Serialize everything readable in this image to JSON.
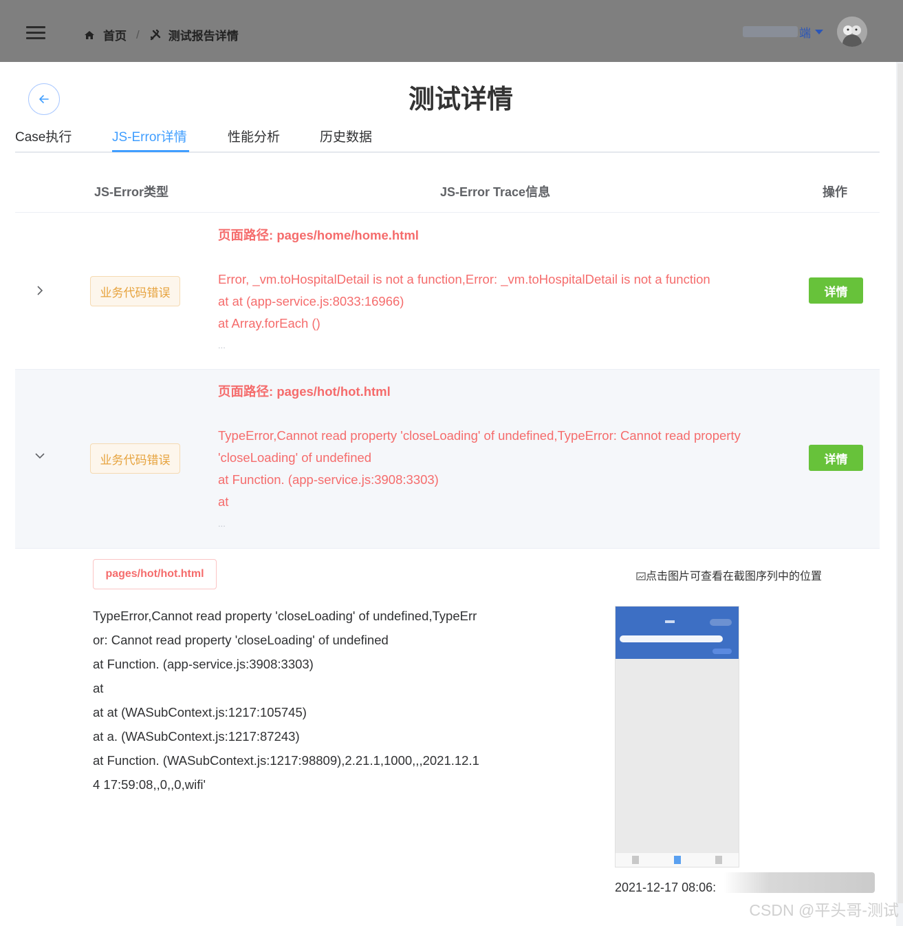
{
  "header": {
    "breadcrumb": [
      {
        "label": "首页",
        "icon": "home-icon"
      },
      {
        "label": "测试报告详情",
        "icon": "tools-icon"
      }
    ],
    "user_name": "端"
  },
  "page": {
    "title": "测试详情"
  },
  "tabs": [
    {
      "label": "Case执行",
      "active": false
    },
    {
      "label": "JS-Error详情",
      "active": true
    },
    {
      "label": "性能分析",
      "active": false
    },
    {
      "label": "历史数据",
      "active": false
    }
  ],
  "table": {
    "headers": {
      "type": "JS-Error类型",
      "trace": "JS-Error Trace信息",
      "action": "操作"
    },
    "rows": [
      {
        "expanded": false,
        "tag": "业务代码错误",
        "path_label": "页面路径: ",
        "path": "pages/home/home.html",
        "lines": [
          "Error, _vm.toHospitalDetail is not a function,Error: _vm.toHospitalDetail is not a function",
          "at at (app-service.js:8033:16966)",
          "at Array.forEach ()",
          "..."
        ],
        "button": "详情"
      },
      {
        "expanded": true,
        "tag": "业务代码错误",
        "path_label": "页面路径: ",
        "path": "pages/hot/hot.html",
        "lines": [
          "TypeError,Cannot read property 'closeLoading' of undefined,TypeError: Cannot read property",
          "'closeLoading' of undefined",
          "at Function. (app-service.js:3908:3303)",
          "at",
          "..."
        ],
        "button": "详情"
      }
    ]
  },
  "expanded_detail": {
    "path_tag": "pages/hot/hot.html",
    "lines": [
      "TypeError,Cannot read property 'closeLoading' of undefined,TypeErr",
      "or: Cannot read property 'closeLoading' of undefined",
      "at Function. (app-service.js:3908:3303)",
      "at",
      "at at (WASubContext.js:1217:105745)",
      "at a. (WASubContext.js:1217:87243)",
      "at Function. (WASubContext.js:1217:98809),2.21.1,1000,,,2021.12.1",
      "4 17:59:08,,0,,0,wifi'"
    ],
    "hint": "点击图片可查看在截图序列中的位置",
    "timestamp": "2021-12-17 08:06:"
  },
  "watermark": "CSDN @平头哥-测试",
  "colors": {
    "primary": "#409eff",
    "danger": "#f56c6c",
    "warning": "#e6a23c",
    "success": "#67c23a",
    "topbar": "#7f7f7f"
  }
}
